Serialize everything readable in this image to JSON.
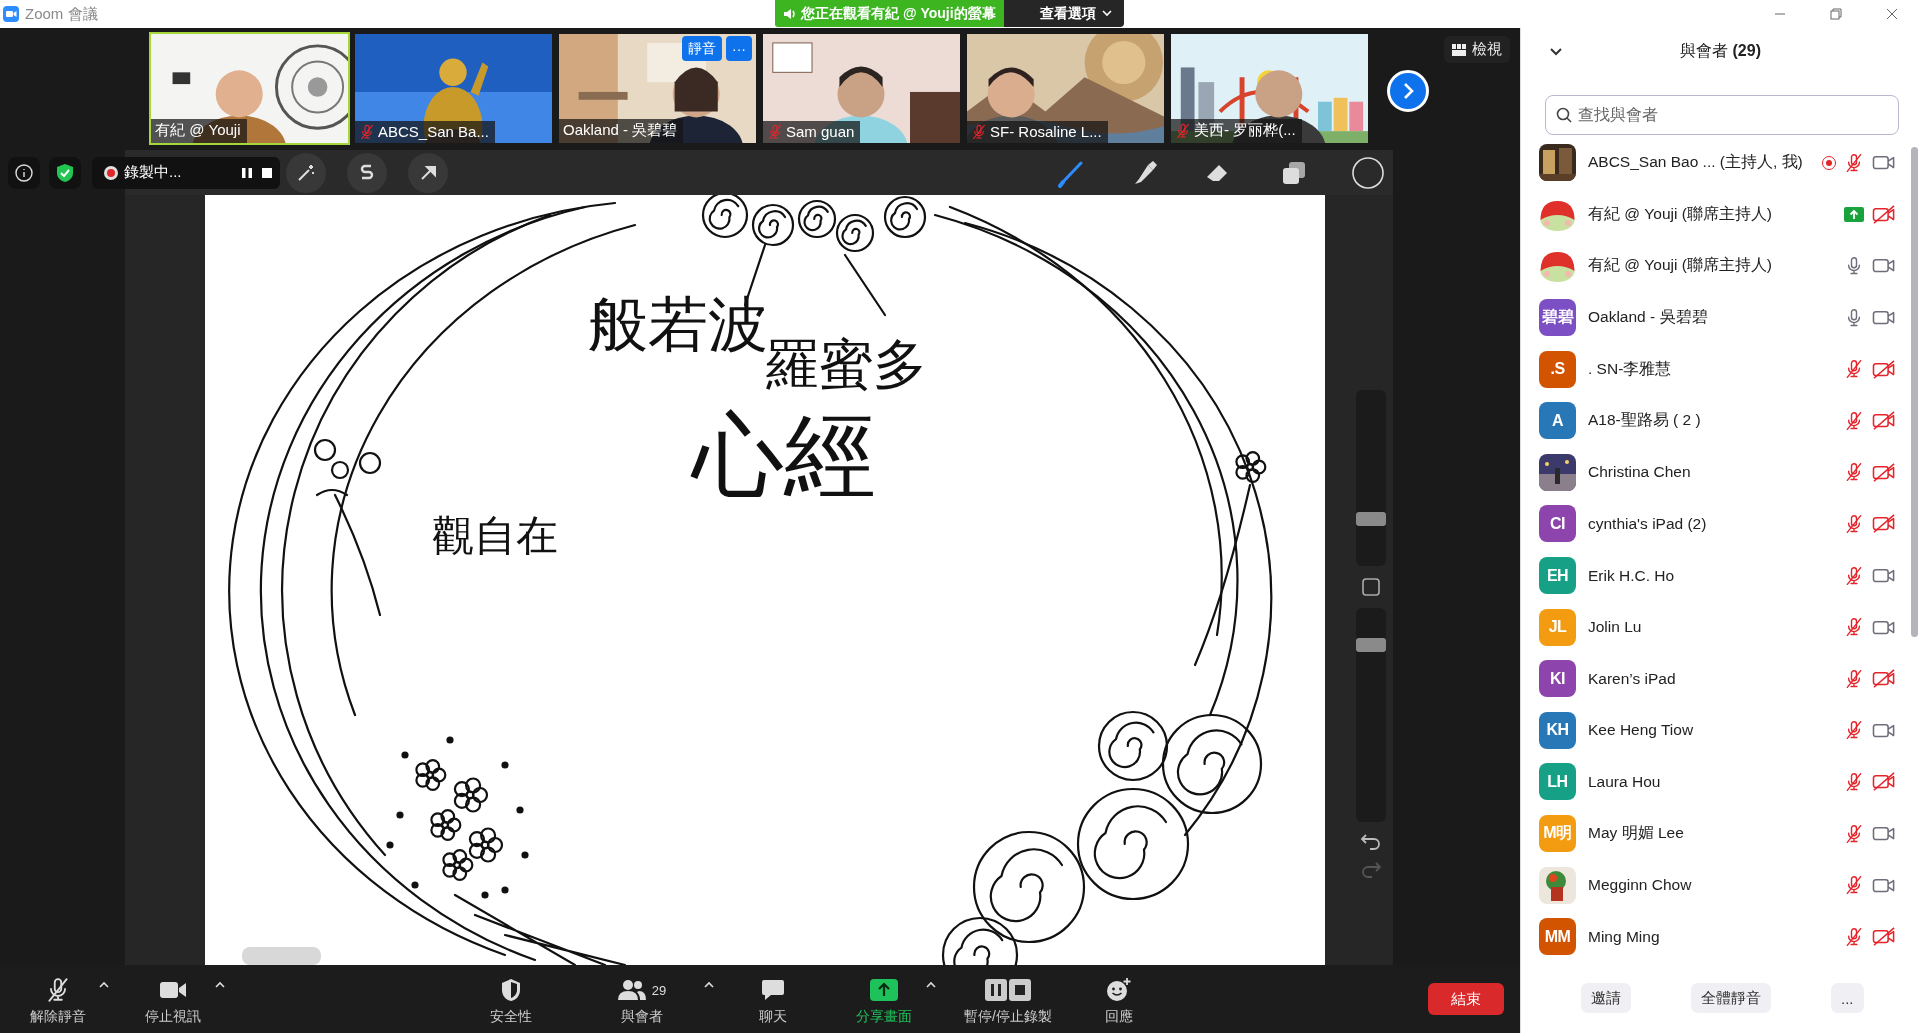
{
  "window": {
    "title": "Zoom 會議"
  },
  "share_banner": {
    "text": "您正在觀看有紀 @ Youji的螢幕",
    "options": "查看選項"
  },
  "video_strip": {
    "tiles": [
      {
        "name": "有紀 @ Youji",
        "muted": false,
        "active": true
      },
      {
        "name": "ABCS_San Ba...",
        "muted": true,
        "active": false
      },
      {
        "name": "Oakland - 吳碧碧",
        "muted": false,
        "active": false,
        "overlay": {
          "mute": "靜音",
          "more": "···"
        }
      },
      {
        "name": "Sam guan",
        "muted": true,
        "active": false
      },
      {
        "name": "SF- Rosaline L...",
        "muted": true,
        "active": false
      },
      {
        "name": "美西- 罗丽桦(...",
        "muted": true,
        "active": false
      }
    ],
    "view_button": "檢視"
  },
  "annotation_toolbar": {
    "recording": "錄製中...",
    "tools": [
      {
        "kind": "wand",
        "selected": false
      },
      {
        "kind": "spotlight",
        "selected": false
      },
      {
        "kind": "arrow",
        "selected": false
      },
      {
        "kind": "pen",
        "selected": true
      },
      {
        "kind": "fill",
        "selected": false
      },
      {
        "kind": "eraser",
        "selected": false
      },
      {
        "kind": "copy",
        "selected": false
      },
      {
        "kind": "shape",
        "selected": false
      }
    ]
  },
  "whiteboard": {
    "texts": [
      "般若波",
      "羅蜜多",
      "心經",
      "觀自在"
    ],
    "side_sliders": [
      {
        "level": 0.25
      },
      {
        "level": 0.85
      }
    ]
  },
  "bottom_toolbar": {
    "controls": [
      {
        "kind": "unmute",
        "label": "解除靜音",
        "caret": true
      },
      {
        "kind": "video",
        "label": "停止視訊",
        "caret": true
      },
      {
        "kind": "security",
        "label": "安全性",
        "caret": false
      },
      {
        "kind": "participants",
        "label": "與會者",
        "count": "29",
        "caret": true
      },
      {
        "kind": "chat",
        "label": "聊天",
        "caret": false
      },
      {
        "kind": "share",
        "label": "分享畫面",
        "caret": true
      },
      {
        "kind": "record",
        "label": "暫停/停止錄製",
        "caret": false
      },
      {
        "kind": "reactions",
        "label": "回應",
        "caret": false
      }
    ],
    "end_button": "結束"
  },
  "participants_panel": {
    "title": "與會者 **(29)**",
    "search_placeholder": "查找與會者",
    "participants": [
      {
        "name": "ABCS_San Bao ... (主持人, 我)",
        "recording": true,
        "audio": {
          "kind": "muted"
        },
        "video_on": true
      },
      {
        "name": "有紀 @ Youji (聯席主持人)",
        "avatar": {
          "kind": "cartoon"
        },
        "recording": false,
        "audio": {
          "kind": "sharing"
        },
        "video_on": false
      },
      {
        "name": "有紀 @ Youji (聯席主持人)",
        "avatar": {
          "kind": "cartoon"
        },
        "recording": false,
        "audio": {
          "kind": "on"
        },
        "video_on": true
      },
      {
        "name": "Oakland - 吳碧碧",
        "avatar": {
          "kind": "initials",
          "text": "碧碧",
          "color": "#7d4fc4"
        },
        "recording": false,
        "audio": {
          "kind": "on"
        },
        "video_on": true
      },
      {
        "name": ".   SN-李雅慧",
        "avatar": {
          "kind": "initials",
          "text": ".S",
          "color": "#d35400"
        },
        "recording": false,
        "audio": {
          "kind": "muted"
        },
        "video_on": false
      },
      {
        "name": "A18-聖路易 ( 2 )",
        "avatar": {
          "kind": "initials",
          "text": "A",
          "color": "#2878b8"
        },
        "recording": false,
        "audio": {
          "kind": "muted"
        },
        "video_on": false
      },
      {
        "name": "Christina Chen",
        "recording": false,
        "audio": {
          "kind": "muted"
        },
        "video_on": false
      },
      {
        "name": "cynthia's iPad (2)",
        "avatar": {
          "kind": "initials",
          "text": "CI",
          "color": "#8e44ad"
        },
        "recording": false,
        "audio": {
          "kind": "muted"
        },
        "video_on": false
      },
      {
        "name": "Erik H.C. Ho",
        "avatar": {
          "kind": "initials",
          "text": "EH",
          "color": "#16a085"
        },
        "recording": false,
        "audio": {
          "kind": "muted"
        },
        "video_on": true
      },
      {
        "name": "Jolin Lu",
        "avatar": {
          "kind": "initials",
          "text": "JL",
          "color": "#f39c12"
        },
        "recording": false,
        "audio": {
          "kind": "muted"
        },
        "video_on": true
      },
      {
        "name": "Karen’s iPad",
        "avatar": {
          "kind": "initials",
          "text": "KI",
          "color": "#8e44ad"
        },
        "recording": false,
        "audio": {
          "kind": "muted"
        },
        "video_on": false
      },
      {
        "name": "Kee Heng Tiow",
        "avatar": {
          "kind": "initials",
          "text": "KH",
          "color": "#2878b8"
        },
        "recording": false,
        "audio": {
          "kind": "muted"
        },
        "video_on": true
      },
      {
        "name": "Laura Hou",
        "avatar": {
          "kind": "initials",
          "text": "LH",
          "color": "#16a085"
        },
        "recording": false,
        "audio": {
          "kind": "muted"
        },
        "video_on": false
      },
      {
        "name": "May 明媚 Lee",
        "avatar": {
          "kind": "initials",
          "text": "M明",
          "color": "#f39c12"
        },
        "recording": false,
        "audio": {
          "kind": "muted"
        },
        "video_on": true
      },
      {
        "name": "Megginn Chow",
        "recording": false,
        "audio": {
          "kind": "muted"
        },
        "video_on": true
      },
      {
        "name": "Ming Ming",
        "avatar": {
          "kind": "initials",
          "text": "MM",
          "color": "#d35400"
        },
        "recording": false,
        "audio": {
          "kind": "muted"
        },
        "video_on": false
      }
    ],
    "buttons": [
      "邀請",
      "全體靜音",
      "..."
    ]
  }
}
